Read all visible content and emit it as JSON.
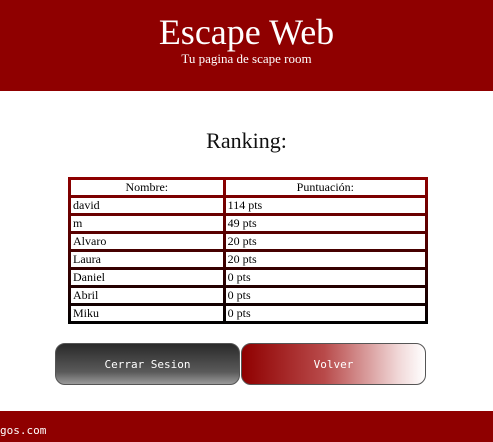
{
  "header": {
    "title": "Escape Web",
    "subtitle": "Tu pagina de scape room"
  },
  "ranking": {
    "title": "Ranking:",
    "columns": [
      "Nombre:",
      "Puntuación:"
    ],
    "rows": [
      {
        "name": "david",
        "score": "114 pts"
      },
      {
        "name": "m",
        "score": "49 pts"
      },
      {
        "name": "Alvaro",
        "score": "20 pts"
      },
      {
        "name": "Laura",
        "score": "20 pts"
      },
      {
        "name": "Daniel",
        "score": "0 pts"
      },
      {
        "name": "Abril",
        "score": "0 pts"
      },
      {
        "name": "Miku",
        "score": "0 pts"
      }
    ]
  },
  "buttons": {
    "logout_label": "Cerrar Sesion",
    "back_label": "Volver"
  },
  "footer": {
    "text": "gos.com"
  },
  "colors": {
    "brand": "#8f0000",
    "table_border": "#000000"
  }
}
